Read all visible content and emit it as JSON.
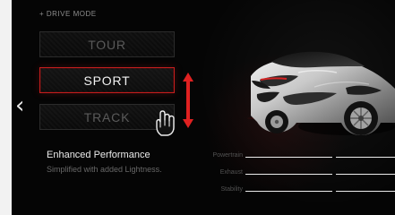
{
  "screen": {
    "drive_mode_label": "+ DRIVE MODE"
  },
  "modes": [
    {
      "label": "TOUR",
      "state": "inactive"
    },
    {
      "label": "SPORT",
      "state": "selected"
    },
    {
      "label": "TRACK",
      "state": "inactive"
    }
  ],
  "description": {
    "title": "Enhanced Performance",
    "subtitle": "Simplified with added Lightness."
  },
  "metrics": [
    {
      "label": "Powertrain"
    },
    {
      "label": "Exhaust"
    },
    {
      "label": "Stability"
    }
  ],
  "icons": {
    "back": "chevron-left-icon",
    "cursor": "hand-cursor-icon",
    "arrow": "up-down-arrow-icon"
  },
  "colors": {
    "accent_red": "#c61d1d",
    "inactive_text": "#5a5a5a",
    "active_text": "#f2f2f2",
    "background": "#050505"
  }
}
